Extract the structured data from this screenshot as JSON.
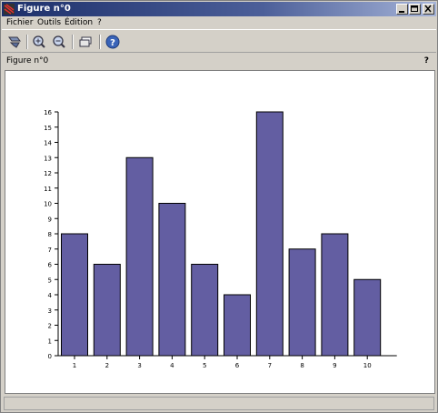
{
  "window": {
    "title": "Figure n°0",
    "buttons": [
      "minimize",
      "maximize",
      "close"
    ]
  },
  "menubar": {
    "items": [
      {
        "label": "Fichier"
      },
      {
        "label": "Outils"
      },
      {
        "label": "Édition"
      },
      {
        "label": "?"
      }
    ]
  },
  "toolbar": {
    "tools": [
      {
        "icon": "rotate-icon"
      },
      {
        "icon": "zoom-in-icon"
      },
      {
        "icon": "zoom-out-icon"
      },
      {
        "icon": "datatip-icon"
      },
      {
        "icon": "help-icon"
      }
    ]
  },
  "figure_header": {
    "label": "Figure n°0",
    "help": "?"
  },
  "colors": {
    "bar_fill": "#635ea2",
    "bar_stroke": "#000000",
    "title_gradient_start": "#1c2f6a",
    "title_gradient_end": "#a6b4d8",
    "window_bg": "#d4d0c8"
  },
  "chart_data": {
    "type": "bar",
    "categories": [
      "1",
      "2",
      "3",
      "4",
      "5",
      "6",
      "7",
      "8",
      "9",
      "10"
    ],
    "values": [
      8,
      6,
      13,
      10,
      6,
      4,
      16,
      7,
      8,
      5
    ],
    "title": "",
    "xlabel": "",
    "ylabel": "",
    "ylim": [
      0,
      16
    ],
    "yticks": [
      0,
      1,
      2,
      3,
      4,
      5,
      6,
      7,
      8,
      9,
      10,
      11,
      12,
      13,
      14,
      15,
      16
    ],
    "grid": false,
    "legend": "none"
  }
}
